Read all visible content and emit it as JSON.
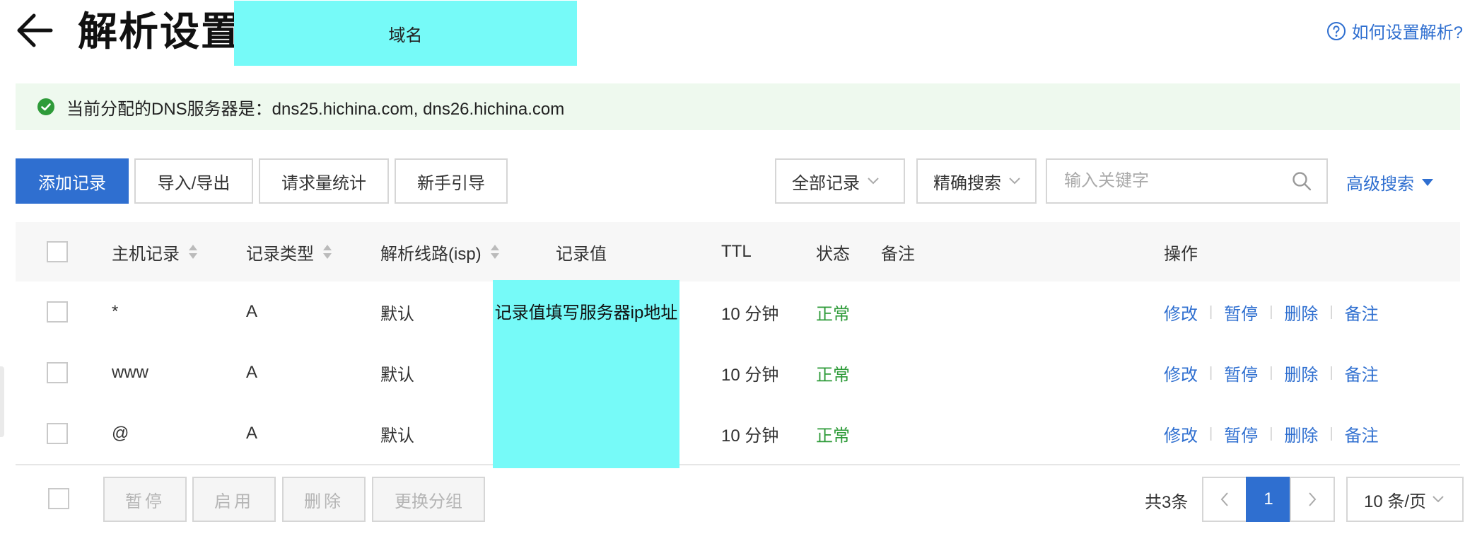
{
  "header": {
    "title": "解析设置",
    "domain_label": "域名",
    "help_link": "如何设置解析?"
  },
  "dns_banner": {
    "text": "当前分配的DNS服务器是：dns25.hichina.com, dns26.hichina.com"
  },
  "toolbar": {
    "add_record": "添加记录",
    "import_export": "导入/导出",
    "request_stats": "请求量统计",
    "beginner_guide": "新手引导",
    "record_filter": "全部记录",
    "search_mode": "精确搜索",
    "search_placeholder": "输入关键字",
    "advanced_search": "高级搜索"
  },
  "table": {
    "columns": {
      "host": "主机记录",
      "type": "记录类型",
      "line": "解析线路(isp)",
      "value": "记录值",
      "ttl": "TTL",
      "status": "状态",
      "remark": "备注",
      "actions": "操作"
    },
    "value_note": "记录值填写服务器ip地址",
    "rows": [
      {
        "host": "*",
        "type": "A",
        "line": "默认",
        "ttl": "10 分钟",
        "status": "正常"
      },
      {
        "host": "www",
        "type": "A",
        "line": "默认",
        "ttl": "10 分钟",
        "status": "正常"
      },
      {
        "host": "@",
        "type": "A",
        "line": "默认",
        "ttl": "10 分钟",
        "status": "正常"
      }
    ],
    "row_actions": {
      "edit": "修改",
      "pause": "暂停",
      "delete": "删除",
      "remark": "备注"
    }
  },
  "footer": {
    "pause": "暂停",
    "enable": "启用",
    "delete": "删除",
    "change_group": "更换分组",
    "total": "共3条",
    "current_page": "1",
    "page_size": "10 条/页"
  },
  "colors": {
    "accent": "#2f6fd0",
    "status_ok": "#2e9b39",
    "banner_bg": "#eef9ee",
    "mask": "#76faf8"
  }
}
